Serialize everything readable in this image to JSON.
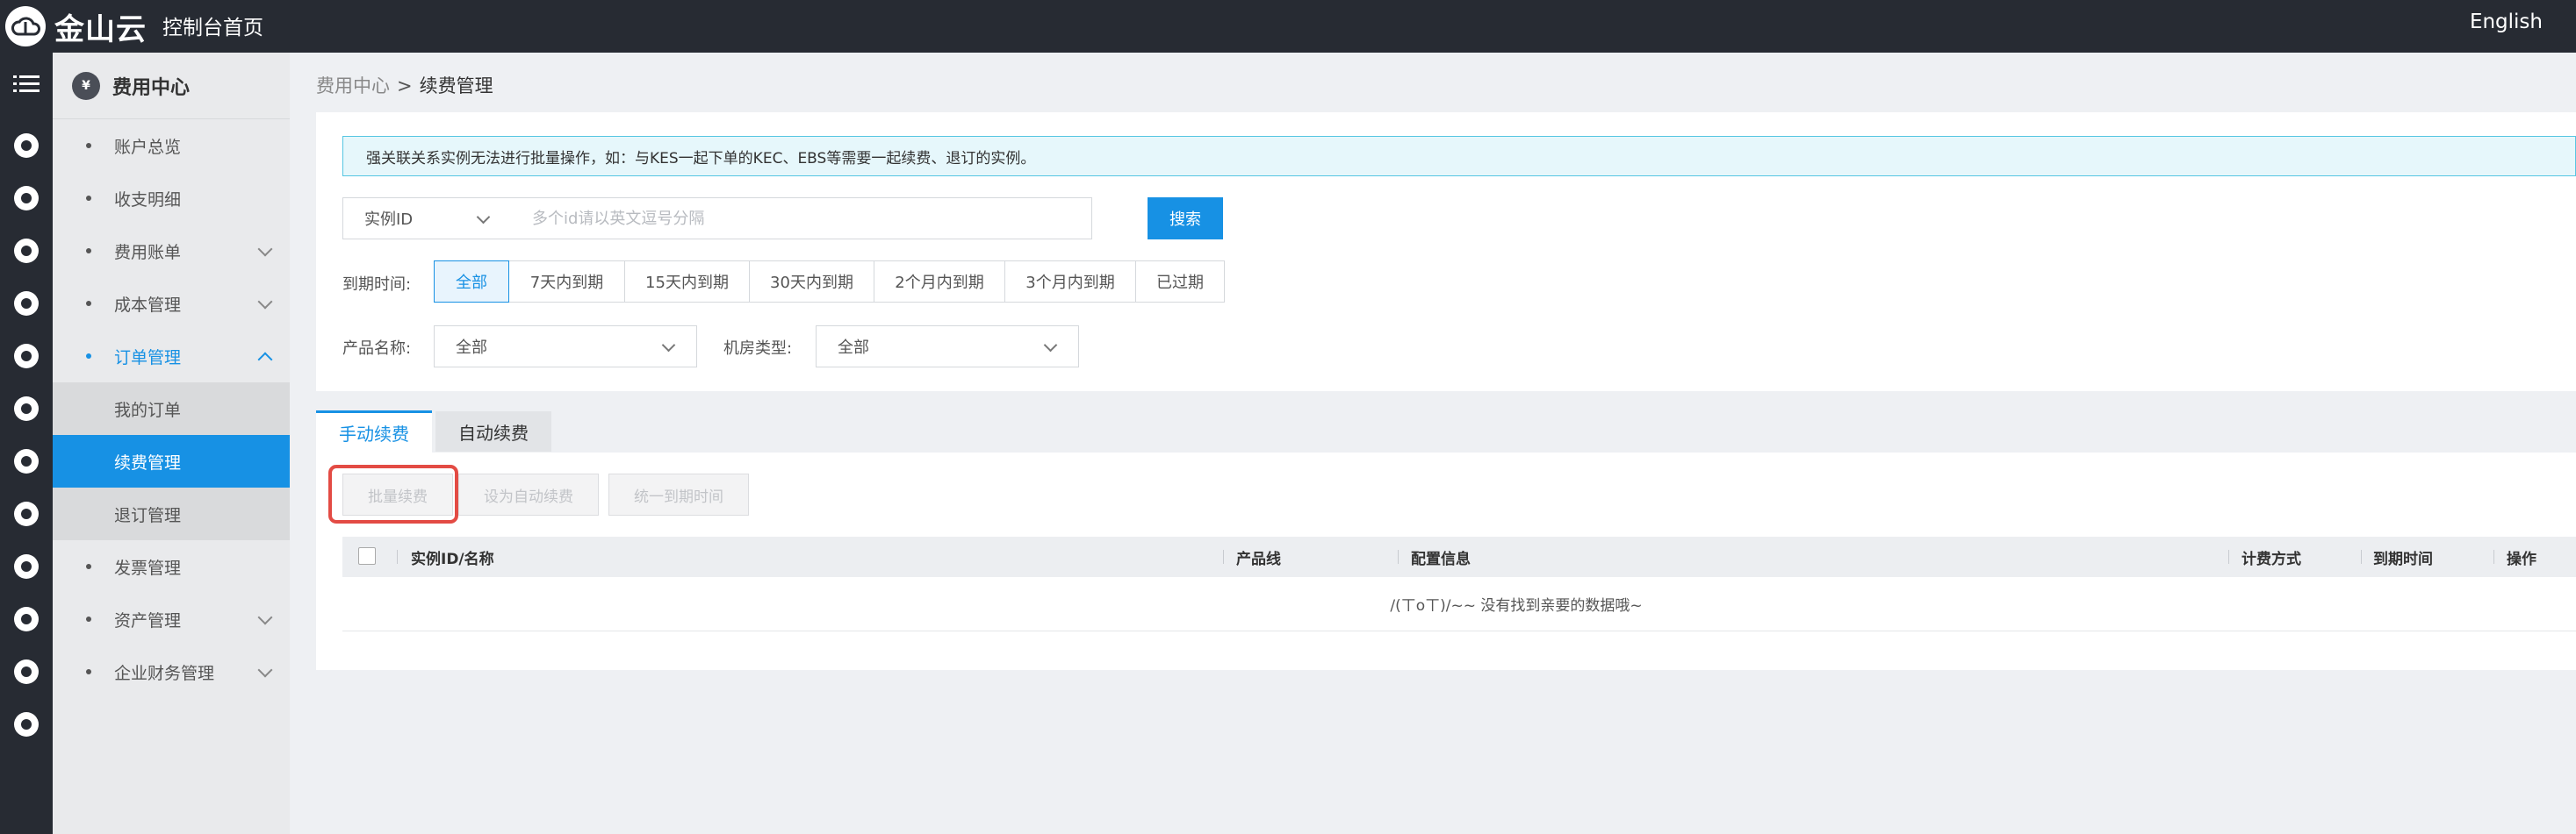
{
  "topbar": {
    "logo_text": "金山云",
    "console_home": "控制台首页",
    "language": "English"
  },
  "rail": {
    "menu_icon": "hamburger-menu-icon",
    "icons": [
      "globe-icon",
      "compass-icon",
      "cloud-icon",
      "database-icon",
      "search-db-icon",
      "server-icon",
      "network-icon",
      "id-card-icon",
      "storage-icon",
      "stack-icon",
      "topology-icon",
      "cloud-service-icon"
    ]
  },
  "subnav": {
    "title": "费用中心",
    "items": [
      {
        "label": "账户总览"
      },
      {
        "label": "收支明细"
      },
      {
        "label": "费用账单"
      },
      {
        "label": "成本管理"
      },
      {
        "label": "订单管理"
      },
      {
        "label": "发票管理"
      },
      {
        "label": "资产管理"
      },
      {
        "label": "企业财务管理"
      }
    ],
    "order_subitems": [
      {
        "label": "我的订单"
      },
      {
        "label": "续费管理"
      },
      {
        "label": "退订管理"
      }
    ]
  },
  "breadcrumb": {
    "parent": "费用中心",
    "separator": ">",
    "current": "续费管理"
  },
  "notice": "强关联关系实例无法进行批量操作，如：与KES一起下单的KEC、EBS等需要一起续费、退订的实例。",
  "search": {
    "field_select": "实例ID",
    "placeholder": "多个id请以英文逗号分隔",
    "button": "搜索"
  },
  "filters": {
    "expiry_label": "到期时间:",
    "expiry_options": [
      "全部",
      "7天内到期",
      "15天内到期",
      "30天内到期",
      "2个月内到期",
      "3个月内到期",
      "已过期"
    ],
    "expiry_selected": "全部",
    "product_label": "产品名称:",
    "product_value": "全部",
    "room_label": "机房类型:",
    "room_value": "全部"
  },
  "tabs": {
    "manual": "手动续费",
    "auto": "自动续费"
  },
  "actions": {
    "batch_renew": "批量续费",
    "set_auto_renew": "设为自动续费",
    "unify_expiry": "统一到期时间"
  },
  "table": {
    "columns": [
      "实例ID/名称",
      "产品线",
      "配置信息",
      "计费方式",
      "到期时间",
      "操作"
    ],
    "empty_text": "/(ㄒoㄒ)/~~ 没有找到亲要的数据哦~"
  },
  "colors": {
    "accent": "#1791e4",
    "topbar": "#272b33",
    "highlight": "#e34b44",
    "notice_bg": "#e6f7fb"
  }
}
